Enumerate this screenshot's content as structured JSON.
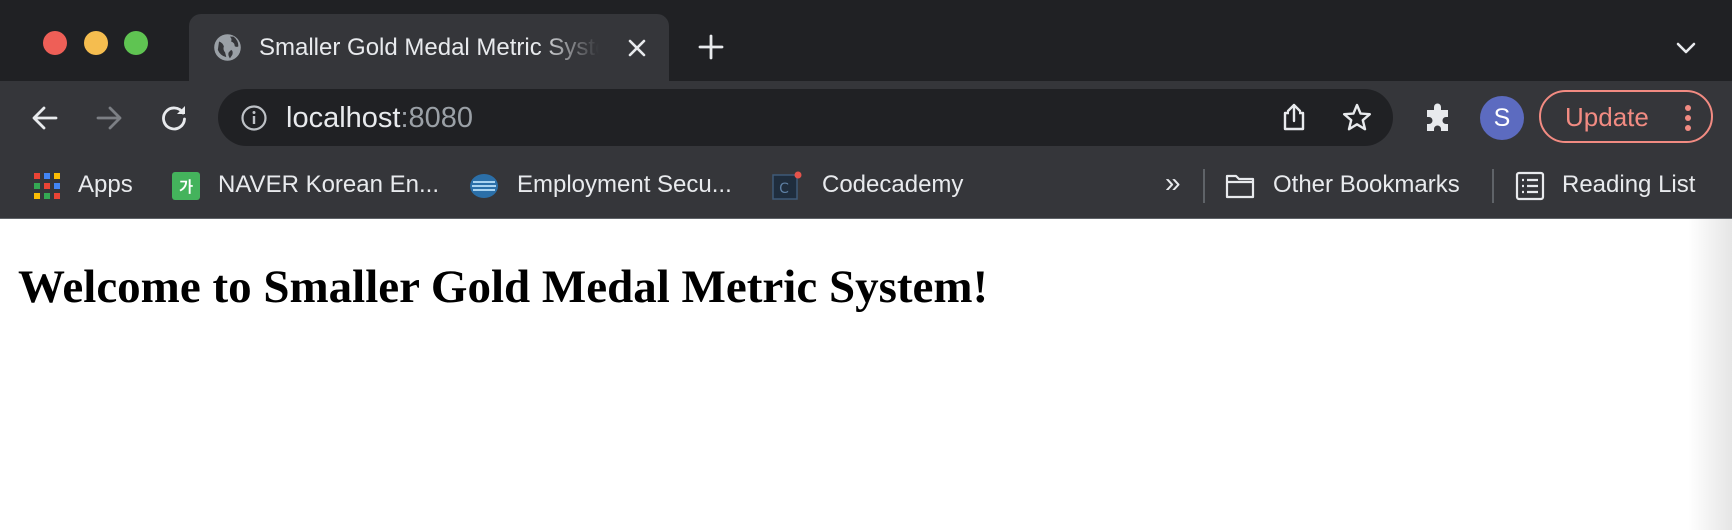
{
  "tab": {
    "title": "Smaller Gold Medal Metric System",
    "favicon": "globe-icon"
  },
  "omnibox": {
    "host": "localhost",
    "port": ":8080"
  },
  "profile": {
    "initial": "S"
  },
  "update_button": {
    "label": "Update"
  },
  "bookmarks": {
    "items": [
      {
        "label": "Apps",
        "icon": "apps-grid-icon"
      },
      {
        "label": "NAVER Korean En...",
        "icon": "naver-dictionary-icon"
      },
      {
        "label": "Employment Secu...",
        "icon": "employment-security-icon"
      },
      {
        "label": "Codecademy",
        "icon": "codecademy-icon"
      }
    ],
    "overflow": "»",
    "other_bookmarks": "Other Bookmarks",
    "reading_list": "Reading List"
  },
  "page": {
    "heading": "Welcome to Smaller Gold Medal Metric System!"
  },
  "colors": {
    "tab_strip": "#202124",
    "toolbar": "#35363a",
    "omnibox": "#202124",
    "update_accent": "#f28b82",
    "avatar": "#5c6bc0"
  }
}
